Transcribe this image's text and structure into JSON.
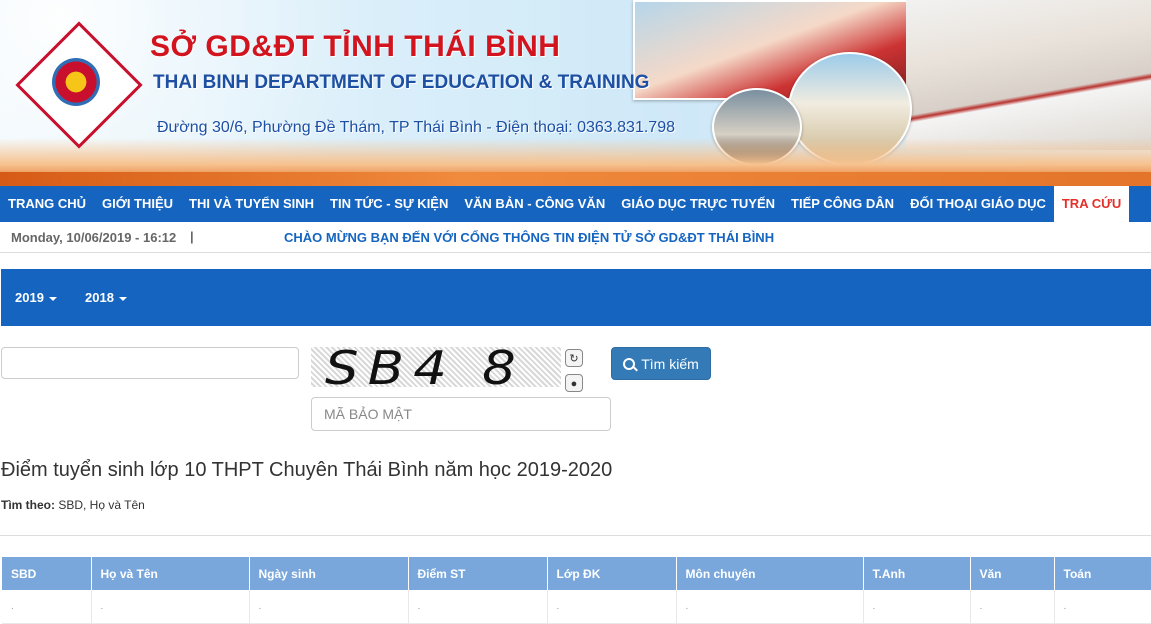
{
  "header": {
    "title": "SỞ GD&ĐT TỈNH THÁI BÌNH",
    "subtitle": "THAI BINH DEPARTMENT OF EDUCATION & TRAINING",
    "address": "Đường 30/6, Phường Đề Thám, TP Thái Bình - Điện thoại: 0363.831.798"
  },
  "nav": {
    "items": [
      {
        "label": "TRANG CHỦ"
      },
      {
        "label": "GIỚI THIỆU"
      },
      {
        "label": "THI VÀ TUYỂN SINH"
      },
      {
        "label": "TIN TỨC - SỰ KIỆN"
      },
      {
        "label": "VĂN BẢN - CÔNG VĂN"
      },
      {
        "label": "GIÁO DỤC TRỰC TUYẾN"
      },
      {
        "label": "TIẾP CÔNG DÂN"
      },
      {
        "label": "ĐỐI THOẠI GIÁO DỤC"
      },
      {
        "label": "TRA CỨU"
      }
    ],
    "active_color": "#e4302a"
  },
  "ticker": {
    "date": "Monday, 10/06/2019 - 16:12",
    "separator": "|",
    "message": "CHÀO MỪNG BẠN ĐẾN VỚI CỔNG THÔNG TIN ĐIỆN TỬ SỞ GD&ĐT THÁI BÌNH"
  },
  "years": [
    {
      "label": "2019"
    },
    {
      "label": "2018"
    }
  ],
  "search": {
    "query_value": "",
    "captcha_text": "SB4 8",
    "refresh_icon": "↻",
    "audio_icon": "●",
    "button_label": "Tìm kiếm",
    "code_placeholder": "MÃ BẢO MẬT"
  },
  "content": {
    "title": "Điểm tuyển sinh lớp 10 THPT Chuyên Thái Bình năm học 2019-2020",
    "search_by_label": "Tìm theo:",
    "search_by_value": " SBD, Họ và Tên"
  },
  "table": {
    "headers": [
      "SBD",
      "Họ và Tên",
      "Ngày sinh",
      "Điểm ST",
      "Lớp ĐK",
      "Môn chuyên",
      "T.Anh",
      "Văn",
      "Toán"
    ],
    "row": [
      ".",
      ".",
      ".",
      ".",
      ".",
      ".",
      ".",
      ".",
      "."
    ]
  },
  "colors": {
    "brand_blue": "#1565c0",
    "header_red": "#d2141e",
    "table_header": "#79a7dc",
    "button_blue": "#337ab7"
  }
}
